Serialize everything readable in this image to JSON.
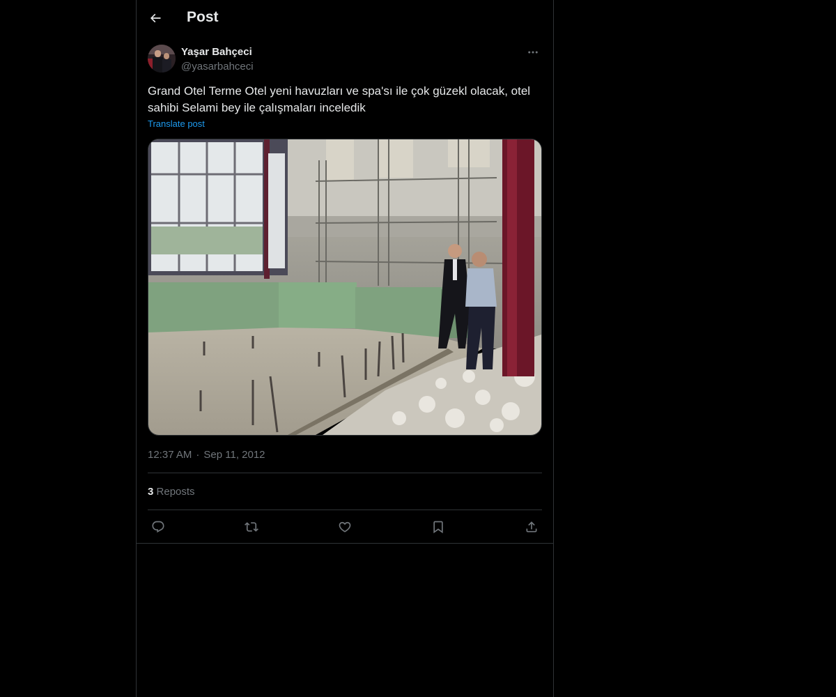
{
  "header": {
    "title": "Post",
    "back_icon": "arrow-left-icon"
  },
  "post": {
    "author_name": "Yaşar Bahçeci",
    "author_handle": "@yasarbahceci",
    "text": "Grand Otel Terme Otel yeni havuzları ve spa'sı ile çok güzekl olacak, otel sahibi Selami bey ile çalışmaları inceledik",
    "translate_label": "Translate post",
    "time": "12:37 AM",
    "separator": "·",
    "date": "Sep 11, 2012",
    "reposts_count": "3",
    "reposts_label": "Reposts"
  },
  "actions": {
    "icons": [
      "reply-icon",
      "repost-icon",
      "like-icon",
      "bookmark-icon",
      "share-icon"
    ]
  },
  "colors": {
    "background": "#000000",
    "text": "#e7e9ea",
    "secondary": "#71767b",
    "link": "#1d9bf0",
    "border": "#2f3336"
  }
}
